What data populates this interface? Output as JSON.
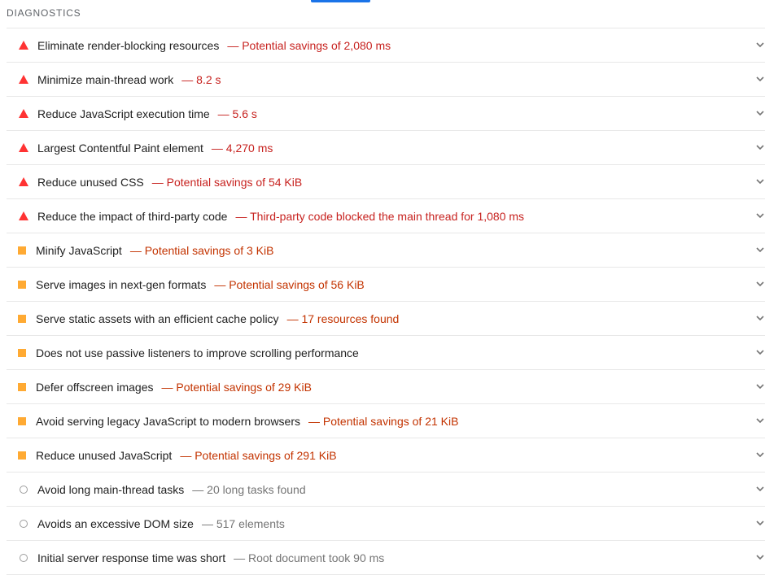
{
  "section": {
    "title": "DIAGNOSTICS"
  },
  "colors": {
    "fail": "#ff3333",
    "average": "#ffaa33",
    "info": "#9e9e9e",
    "accent": "#1a73e8"
  },
  "audits": [
    {
      "status": "fail",
      "title": "Eliminate render-blocking resources",
      "detail": "— Potential savings of 2,080 ms"
    },
    {
      "status": "fail",
      "title": "Minimize main-thread work",
      "detail": "— 8.2 s"
    },
    {
      "status": "fail",
      "title": "Reduce JavaScript execution time",
      "detail": "— 5.6 s"
    },
    {
      "status": "fail",
      "title": "Largest Contentful Paint element",
      "detail": "— 4,270 ms"
    },
    {
      "status": "fail",
      "title": "Reduce unused CSS",
      "detail": "— Potential savings of 54 KiB"
    },
    {
      "status": "fail",
      "title": "Reduce the impact of third-party code",
      "detail": "— Third-party code blocked the main thread for 1,080 ms"
    },
    {
      "status": "average",
      "title": "Minify JavaScript",
      "detail": "— Potential savings of 3 KiB"
    },
    {
      "status": "average",
      "title": "Serve images in next-gen formats",
      "detail": "— Potential savings of 56 KiB"
    },
    {
      "status": "average",
      "title": "Serve static assets with an efficient cache policy",
      "detail": "— 17 resources found"
    },
    {
      "status": "average",
      "title": "Does not use passive listeners to improve scrolling performance",
      "detail": ""
    },
    {
      "status": "average",
      "title": "Defer offscreen images",
      "detail": "— Potential savings of 29 KiB"
    },
    {
      "status": "average",
      "title": "Avoid serving legacy JavaScript to modern browsers",
      "detail": "— Potential savings of 21 KiB"
    },
    {
      "status": "average",
      "title": "Reduce unused JavaScript",
      "detail": "— Potential savings of 291 KiB"
    },
    {
      "status": "info",
      "title": "Avoid long main-thread tasks",
      "detail": "— 20 long tasks found"
    },
    {
      "status": "info",
      "title": "Avoids an excessive DOM size",
      "detail": "— 517 elements"
    },
    {
      "status": "info",
      "title": "Initial server response time was short",
      "detail": "— Root document took 90 ms"
    }
  ]
}
